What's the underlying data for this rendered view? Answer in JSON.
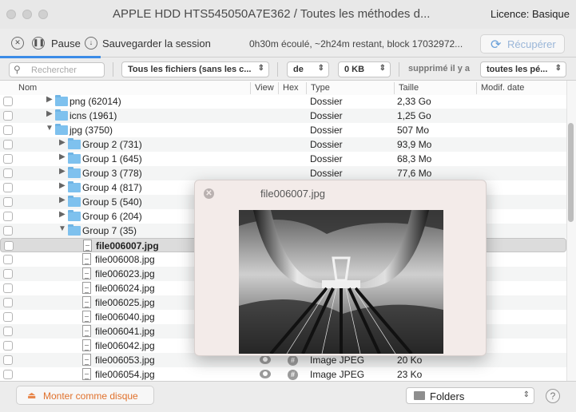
{
  "window": {
    "title": "APPLE HDD HTS545050A7E362 / Toutes les méthodes d...",
    "licence": "Licence: Basique"
  },
  "toolbar": {
    "pause_label": "Pause",
    "save_session_label": "Sauvegarder la session",
    "status": "0h30m écoulé, ~2h24m restant, block 17032972...",
    "recover_label": "Récupérer"
  },
  "filters": {
    "search_placeholder": "Rechercher",
    "file_filter": "Tous les fichiers (sans les c...",
    "size_from": "de",
    "size_value": "0 KB",
    "deleted_label": "supprimé il y a",
    "period": "toutes les pé..."
  },
  "columns": {
    "name": "Nom",
    "view": "View",
    "hex": "Hex",
    "type": "Type",
    "size": "Taille",
    "modified": "Modif. date"
  },
  "rows": [
    {
      "name": "png (62014)",
      "type": "Dossier",
      "size": "2,33 Go"
    },
    {
      "name": "icns (1961)",
      "type": "Dossier",
      "size": "1,25 Go"
    },
    {
      "name": "jpg (3750)",
      "type": "Dossier",
      "size": "507 Mo"
    },
    {
      "name": "Group 2 (731)",
      "type": "Dossier",
      "size": "93,9 Mo"
    },
    {
      "name": "Group 1 (645)",
      "type": "Dossier",
      "size": "68,3 Mo"
    },
    {
      "name": "Group 3 (778)",
      "type": "Dossier",
      "size": "77,6 Mo"
    },
    {
      "name": "Group 4 (817)",
      "type": "",
      "size": ""
    },
    {
      "name": "Group 5 (540)",
      "type": "",
      "size": ""
    },
    {
      "name": "Group 6 (204)",
      "type": "",
      "size": ""
    },
    {
      "name": "Group 7 (35)",
      "type": "",
      "size": ""
    },
    {
      "name": "file006007.jpg",
      "type": "",
      "size": ""
    },
    {
      "name": "file006008.jpg",
      "type": "",
      "size": ""
    },
    {
      "name": "file006023.jpg",
      "type": "",
      "size": ""
    },
    {
      "name": "file006024.jpg",
      "type": "",
      "size": ""
    },
    {
      "name": "file006025.jpg",
      "type": "",
      "size": ""
    },
    {
      "name": "file006040.jpg",
      "type": "",
      "size": ""
    },
    {
      "name": "file006041.jpg",
      "type": "",
      "size": ""
    },
    {
      "name": "file006042.jpg",
      "type": "",
      "size": ""
    },
    {
      "name": "file006053.jpg",
      "type": "Image JPEG",
      "size": "20 Ko"
    },
    {
      "name": "file006054.jpg",
      "type": "Image JPEG",
      "size": "23 Ko"
    }
  ],
  "bottom": {
    "mount_label": "Monter comme disque",
    "view_mode": "Folders",
    "help": "?"
  },
  "preview": {
    "title": "file006007.jpg"
  },
  "colors": {
    "accent": "#3c8ce7",
    "mount_orange": "#e0712c",
    "folder_blue": "#7ec1ee"
  }
}
